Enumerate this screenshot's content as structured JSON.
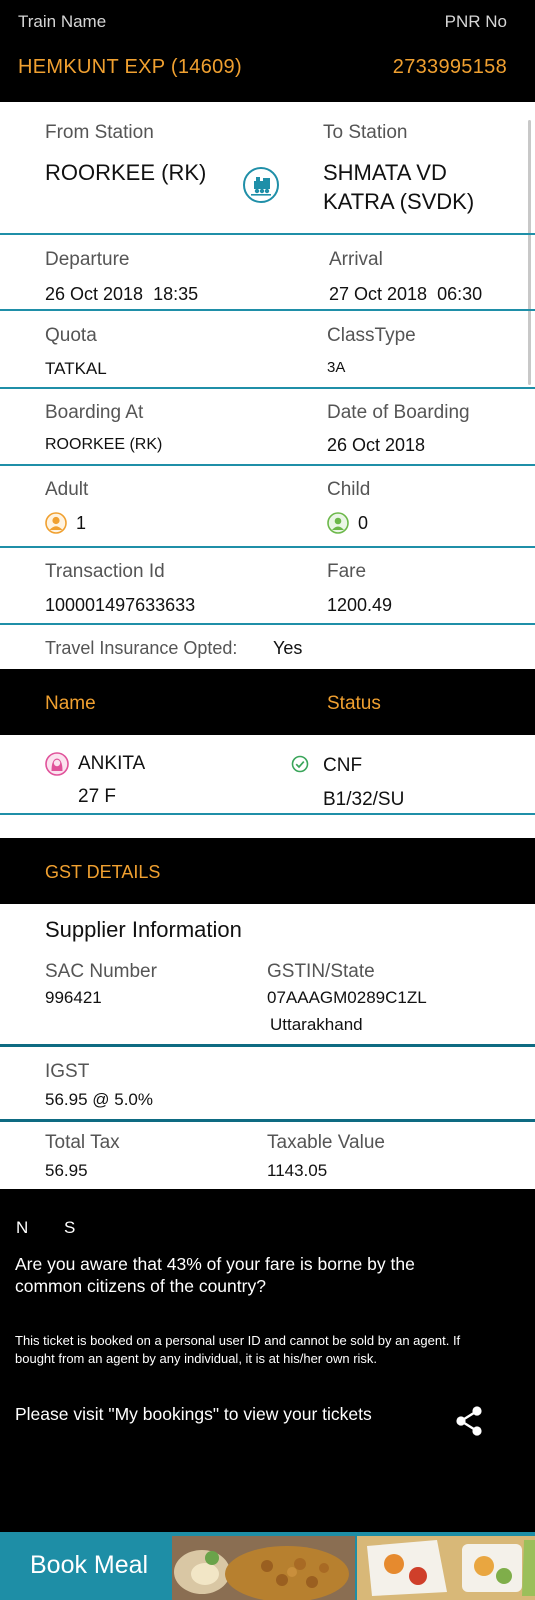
{
  "header": {
    "train_name_label": "Train Name",
    "pnr_label": "PNR No",
    "train_name": "HEMKUNT EXP (14609)",
    "pnr": "2733995158"
  },
  "route": {
    "from_label": "From Station",
    "to_label": "To Station",
    "from_value": "ROORKEE (RK)",
    "to_value_line1": "SHMATA VD",
    "to_value_line2": "KATRA (SVDK)",
    "icon": "train-icon"
  },
  "schedule": {
    "departure_label": "Departure",
    "arrival_label": "Arrival",
    "departure_value": "26 Oct 2018  18:35",
    "arrival_value": "27 Oct 2018  06:30"
  },
  "quota": {
    "quota_label": "Quota",
    "class_label": "ClassType",
    "quota_value": "TATKAL",
    "class_value": "3A"
  },
  "boarding": {
    "boarding_label": "Boarding At",
    "date_label": "Date of Boarding",
    "boarding_value": "ROORKEE (RK)",
    "date_value": "26 Oct 2018"
  },
  "passengers": {
    "adult_label": "Adult",
    "child_label": "Child",
    "adult_value": "1",
    "child_value": "0",
    "adult_icon": "adult-icon",
    "child_icon": "child-icon"
  },
  "transaction": {
    "id_label": "Transaction Id",
    "fare_label": "Fare",
    "id_value": "100001497633633",
    "fare_value": "1200.49"
  },
  "insurance": {
    "label": "Travel Insurance Opted:",
    "value": "Yes"
  },
  "passenger_table": {
    "name_header": "Name",
    "status_header": "Status",
    "rows": [
      {
        "name": "ANKITA",
        "details": "27 F",
        "status": "CNF",
        "berth": "B1/32/SU"
      }
    ]
  },
  "gst": {
    "title": "GST DETAILS",
    "supplier_title": "Supplier Information",
    "sac_label": "SAC Number",
    "sac_value": "996421",
    "gstin_label": "GSTIN/State",
    "gstin_value": "07AAAGM0289C1ZL",
    "state_value": "Uttarakhand",
    "igst_label": "IGST",
    "igst_value": "56.95 @ 5.0%",
    "total_tax_label": "Total Tax",
    "total_tax_value": "56.95",
    "taxable_label": "Taxable Value",
    "taxable_value": "1143.05"
  },
  "footer": {
    "n_label": "N",
    "s_label": "S",
    "awareness_line1": "Are you aware that 43% of your fare is borne by the",
    "awareness_line2": "common citizens of the country?",
    "disclaimer_line1": "This ticket is booked on a personal user ID and cannot be sold by an agent. If",
    "disclaimer_line2": "bought from an agent by any individual, it is at his/her own risk.",
    "bookings_note": "Please visit \"My bookings\" to view your tickets",
    "share_icon": "share-icon"
  },
  "book_meal": {
    "label": "Book Meal"
  },
  "colors": {
    "accent_orange": "#f0a030",
    "teal": "#1f8fa8",
    "confirmed_green": "#3aa55a",
    "female_pink": "#e0529a"
  }
}
